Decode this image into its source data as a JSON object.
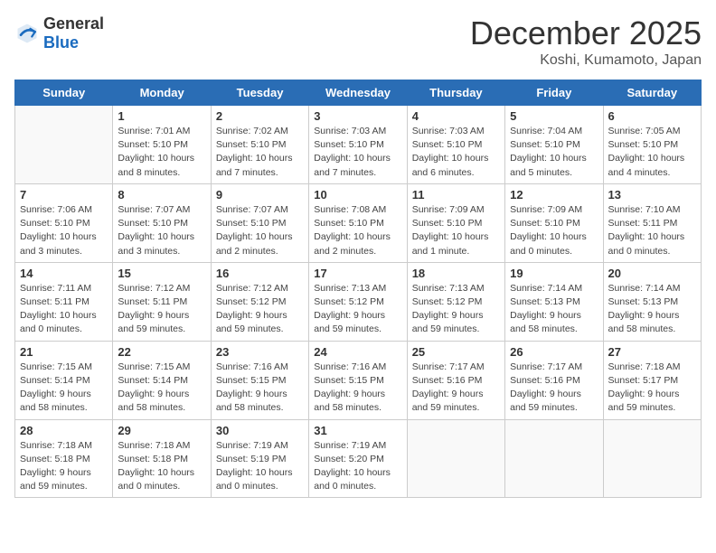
{
  "header": {
    "logo_general": "General",
    "logo_blue": "Blue",
    "month_title": "December 2025",
    "location": "Koshi, Kumamoto, Japan"
  },
  "weekdays": [
    "Sunday",
    "Monday",
    "Tuesday",
    "Wednesday",
    "Thursday",
    "Friday",
    "Saturday"
  ],
  "weeks": [
    [
      {
        "day": "",
        "info": ""
      },
      {
        "day": "1",
        "info": "Sunrise: 7:01 AM\nSunset: 5:10 PM\nDaylight: 10 hours\nand 8 minutes."
      },
      {
        "day": "2",
        "info": "Sunrise: 7:02 AM\nSunset: 5:10 PM\nDaylight: 10 hours\nand 7 minutes."
      },
      {
        "day": "3",
        "info": "Sunrise: 7:03 AM\nSunset: 5:10 PM\nDaylight: 10 hours\nand 7 minutes."
      },
      {
        "day": "4",
        "info": "Sunrise: 7:03 AM\nSunset: 5:10 PM\nDaylight: 10 hours\nand 6 minutes."
      },
      {
        "day": "5",
        "info": "Sunrise: 7:04 AM\nSunset: 5:10 PM\nDaylight: 10 hours\nand 5 minutes."
      },
      {
        "day": "6",
        "info": "Sunrise: 7:05 AM\nSunset: 5:10 PM\nDaylight: 10 hours\nand 4 minutes."
      }
    ],
    [
      {
        "day": "7",
        "info": "Sunrise: 7:06 AM\nSunset: 5:10 PM\nDaylight: 10 hours\nand 3 minutes."
      },
      {
        "day": "8",
        "info": "Sunrise: 7:07 AM\nSunset: 5:10 PM\nDaylight: 10 hours\nand 3 minutes."
      },
      {
        "day": "9",
        "info": "Sunrise: 7:07 AM\nSunset: 5:10 PM\nDaylight: 10 hours\nand 2 minutes."
      },
      {
        "day": "10",
        "info": "Sunrise: 7:08 AM\nSunset: 5:10 PM\nDaylight: 10 hours\nand 2 minutes."
      },
      {
        "day": "11",
        "info": "Sunrise: 7:09 AM\nSunset: 5:10 PM\nDaylight: 10 hours\nand 1 minute."
      },
      {
        "day": "12",
        "info": "Sunrise: 7:09 AM\nSunset: 5:10 PM\nDaylight: 10 hours\nand 0 minutes."
      },
      {
        "day": "13",
        "info": "Sunrise: 7:10 AM\nSunset: 5:11 PM\nDaylight: 10 hours\nand 0 minutes."
      }
    ],
    [
      {
        "day": "14",
        "info": "Sunrise: 7:11 AM\nSunset: 5:11 PM\nDaylight: 10 hours\nand 0 minutes."
      },
      {
        "day": "15",
        "info": "Sunrise: 7:12 AM\nSunset: 5:11 PM\nDaylight: 9 hours\nand 59 minutes."
      },
      {
        "day": "16",
        "info": "Sunrise: 7:12 AM\nSunset: 5:12 PM\nDaylight: 9 hours\nand 59 minutes."
      },
      {
        "day": "17",
        "info": "Sunrise: 7:13 AM\nSunset: 5:12 PM\nDaylight: 9 hours\nand 59 minutes."
      },
      {
        "day": "18",
        "info": "Sunrise: 7:13 AM\nSunset: 5:12 PM\nDaylight: 9 hours\nand 59 minutes."
      },
      {
        "day": "19",
        "info": "Sunrise: 7:14 AM\nSunset: 5:13 PM\nDaylight: 9 hours\nand 58 minutes."
      },
      {
        "day": "20",
        "info": "Sunrise: 7:14 AM\nSunset: 5:13 PM\nDaylight: 9 hours\nand 58 minutes."
      }
    ],
    [
      {
        "day": "21",
        "info": "Sunrise: 7:15 AM\nSunset: 5:14 PM\nDaylight: 9 hours\nand 58 minutes."
      },
      {
        "day": "22",
        "info": "Sunrise: 7:15 AM\nSunset: 5:14 PM\nDaylight: 9 hours\nand 58 minutes."
      },
      {
        "day": "23",
        "info": "Sunrise: 7:16 AM\nSunset: 5:15 PM\nDaylight: 9 hours\nand 58 minutes."
      },
      {
        "day": "24",
        "info": "Sunrise: 7:16 AM\nSunset: 5:15 PM\nDaylight: 9 hours\nand 58 minutes."
      },
      {
        "day": "25",
        "info": "Sunrise: 7:17 AM\nSunset: 5:16 PM\nDaylight: 9 hours\nand 59 minutes."
      },
      {
        "day": "26",
        "info": "Sunrise: 7:17 AM\nSunset: 5:16 PM\nDaylight: 9 hours\nand 59 minutes."
      },
      {
        "day": "27",
        "info": "Sunrise: 7:18 AM\nSunset: 5:17 PM\nDaylight: 9 hours\nand 59 minutes."
      }
    ],
    [
      {
        "day": "28",
        "info": "Sunrise: 7:18 AM\nSunset: 5:18 PM\nDaylight: 9 hours\nand 59 minutes."
      },
      {
        "day": "29",
        "info": "Sunrise: 7:18 AM\nSunset: 5:18 PM\nDaylight: 10 hours\nand 0 minutes."
      },
      {
        "day": "30",
        "info": "Sunrise: 7:19 AM\nSunset: 5:19 PM\nDaylight: 10 hours\nand 0 minutes."
      },
      {
        "day": "31",
        "info": "Sunrise: 7:19 AM\nSunset: 5:20 PM\nDaylight: 10 hours\nand 0 minutes."
      },
      {
        "day": "",
        "info": ""
      },
      {
        "day": "",
        "info": ""
      },
      {
        "day": "",
        "info": ""
      }
    ]
  ]
}
